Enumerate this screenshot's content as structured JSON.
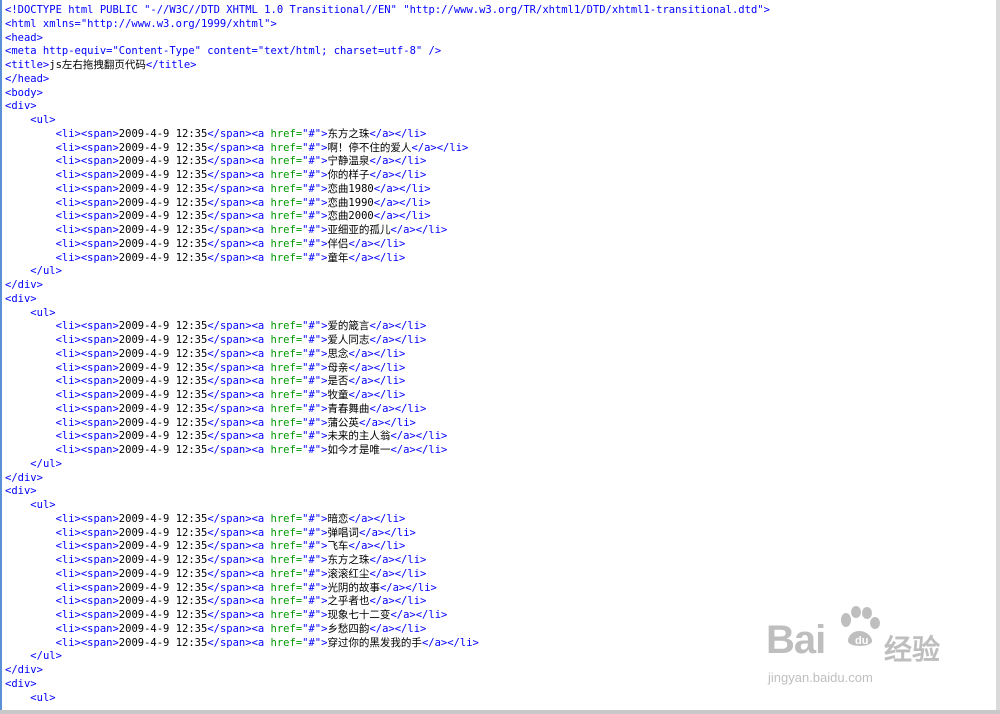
{
  "doc": {
    "doctype": "<!DOCTYPE html PUBLIC \"-//W3C//DTD XHTML 1.0 Transitional//EN\" \"http://www.w3.org/TR/xhtml1/DTD/xhtml1-transitional.dtd\">",
    "html_open": "<html xmlns=\"http://www.w3.org/1999/xhtml\">",
    "meta": "<meta http-equiv=\"Content-Type\" content=\"text/html; charset=utf-8\" />",
    "title_text": "js左右拖拽翻页代码",
    "date": "2009-4-9 12:35"
  },
  "groups": [
    [
      "东方之珠",
      "啊！停不住的爱人",
      "宁静温泉",
      "你的样子",
      "恋曲1980",
      "恋曲1990",
      "恋曲2000",
      "亚细亚的孤儿",
      "伴侣",
      "童年"
    ],
    [
      "爱的箴言",
      "爱人同志",
      "思念",
      "母亲",
      "是否",
      "牧童",
      "青春舞曲",
      "蒲公英",
      "未来的主人翁",
      "如今才是唯一"
    ],
    [
      "暗恋",
      "弹唱词",
      "飞车",
      "东方之珠",
      "滚滚红尘",
      "光阴的故事",
      "之乎者也",
      "现象七十二变",
      "乡愁四韵",
      "穿过你的黑发我的手"
    ]
  ],
  "watermark": {
    "logo": "Bai",
    "logo2": "du",
    "cn": "经验",
    "url": "jingyan.baidu.com",
    "icon": "baidu-paw-icon",
    "color": "#8a8a8a"
  },
  "colors": {
    "tag": "#0000ff",
    "attr": "#009900",
    "text": "#000000",
    "gutter": "#5b8fd6"
  }
}
